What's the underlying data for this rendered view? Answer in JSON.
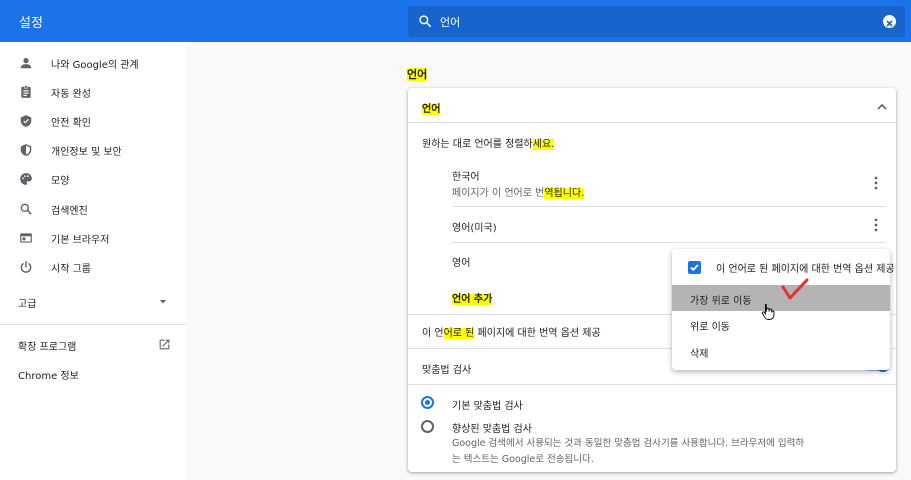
{
  "header": {
    "title": "설정",
    "search_value": "언어"
  },
  "sidebar": {
    "items": [
      {
        "label": "나와 Google의 관계",
        "icon": "person-icon"
      },
      {
        "label": "자동 완성",
        "icon": "clipboard-icon"
      },
      {
        "label": "안전 확인",
        "icon": "shield-check-icon"
      },
      {
        "label": "개인정보 및 보안",
        "icon": "shield-lock-icon"
      },
      {
        "label": "모양",
        "icon": "palette-icon"
      },
      {
        "label": "검색엔진",
        "icon": "search-icon"
      },
      {
        "label": "기본 브라우저",
        "icon": "browser-icon"
      },
      {
        "label": "시작 그룹",
        "icon": "power-icon"
      }
    ],
    "advanced_label": "고급",
    "extensions_label": "확장 프로그램",
    "about_label": "Chrome 정보"
  },
  "main": {
    "section_title": "언어",
    "card_title": "언어",
    "order_desc_a": "원하는 대로 언어를 정렬하",
    "order_desc_b": "세요.",
    "languages": [
      {
        "name": "한국어",
        "desc_a": "페이지가 이 언어로 번",
        "desc_b": "역됩니다."
      },
      {
        "name": "영어(미국)"
      },
      {
        "name": "영어"
      }
    ],
    "add_language": "언어 추가",
    "offer_translate_a": "이 언",
    "offer_translate_b": "어로 된",
    "offer_translate_c": " 페이지에 대한 번역 옵션 제공",
    "spellcheck_title": "맞춤법 검사",
    "spell_basic": "기본 맞춤법 검사",
    "spell_enhanced": "향상된 맞춤법 검사",
    "spell_enhanced_desc1": "Google 검색에서 사용되는 것과 동일한 맞춤법 검사기를 사용합니다. 브라우저에 입력하",
    "spell_enhanced_desc2": "는 텍스트는 Google로 전송됩니다."
  },
  "menu": {
    "offer_translate": "이 언어로 된 페이지에 대한 번역 옵션 제공",
    "move_top": "가장 위로 이동",
    "move_up": "위로 이동",
    "remove": "삭제"
  },
  "colors": {
    "accent": "#1a73e8",
    "highlight": "#ffff00",
    "annotation": "#e8302a"
  }
}
